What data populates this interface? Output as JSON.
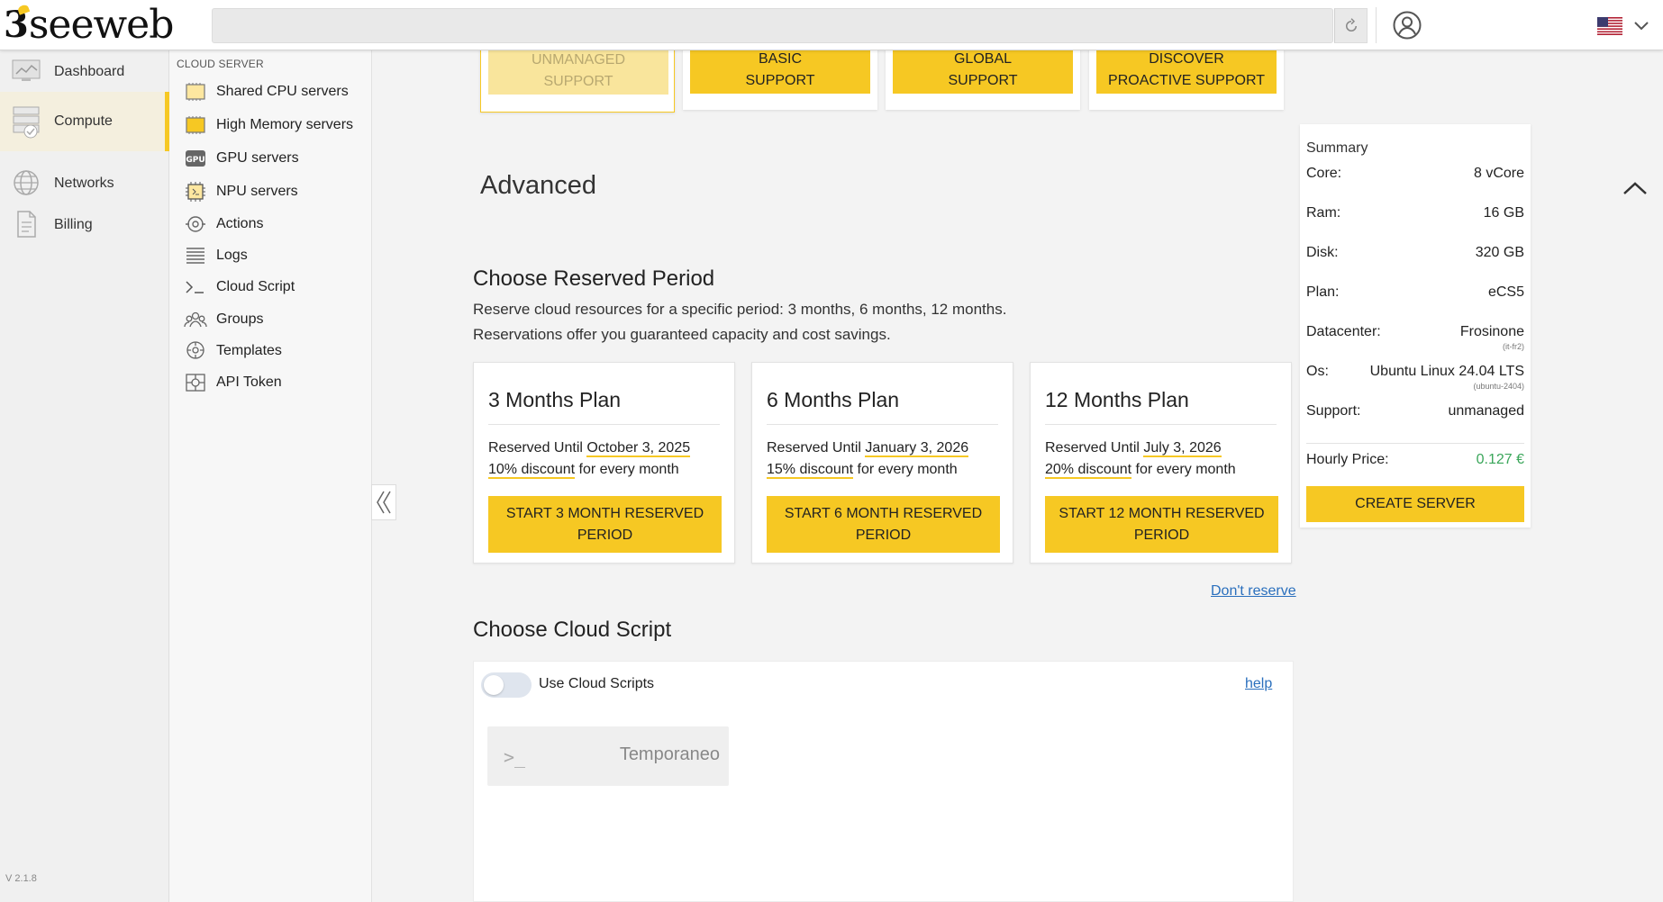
{
  "brand": {
    "name": "seeweb",
    "accent": "#f6c823"
  },
  "leftnav": {
    "items": [
      {
        "label": "Dashboard",
        "icon": "dashboard-icon"
      },
      {
        "label": "Compute",
        "icon": "server-icon",
        "active": true
      },
      {
        "label": "Networks",
        "icon": "globe-icon"
      },
      {
        "label": "Billing",
        "icon": "document-icon"
      }
    ],
    "version": "V 2.1.8"
  },
  "submenu": {
    "header": "CLOUD SERVER",
    "items": [
      {
        "label": "Shared CPU servers",
        "icon": "cpu-chip-icon"
      },
      {
        "label": "High Memory servers",
        "icon": "memory-chip-icon"
      },
      {
        "label": "GPU servers",
        "icon": "gpu-icon"
      },
      {
        "label": "NPU servers",
        "icon": "npu-icon"
      },
      {
        "label": "Actions",
        "icon": "actions-icon"
      },
      {
        "label": "Logs",
        "icon": "logs-icon"
      },
      {
        "label": "Cloud Script",
        "icon": "terminal-icon"
      },
      {
        "label": "Groups",
        "icon": "groups-icon"
      },
      {
        "label": "Templates",
        "icon": "templates-icon"
      },
      {
        "label": "API Token",
        "icon": "api-token-icon"
      }
    ]
  },
  "support": {
    "cards": [
      {
        "line1": "UNMANAGED",
        "line2": "SUPPORT",
        "selected": true
      },
      {
        "line1": "BASIC",
        "line2": "SUPPORT"
      },
      {
        "line1": "GLOBAL",
        "line2": "SUPPORT"
      },
      {
        "line1": "DISCOVER",
        "line2": "PROACTIVE SUPPORT"
      }
    ]
  },
  "advanced": {
    "title": "Advanced"
  },
  "reserved": {
    "title": "Choose Reserved Period",
    "desc1": "Reserve cloud resources for a specific period: 3 months, 6 months, 12 months.",
    "desc2": "Reservations offer you guaranteed capacity and cost savings.",
    "plans": [
      {
        "title": "3 Months Plan",
        "until_prefix": "Reserved Until ",
        "until": "October 3, 2025",
        "discount": "10% discount",
        "suffix": " for every month",
        "btn1": "START 3 MONTH RESERVED",
        "btn2": "PERIOD"
      },
      {
        "title": "6 Months Plan",
        "until_prefix": "Reserved Until ",
        "until": "January 3, 2026",
        "discount": "15% discount",
        "suffix": " for every month",
        "btn1": "START 6 MONTH RESERVED",
        "btn2": "PERIOD"
      },
      {
        "title": "12 Months Plan",
        "until_prefix": "Reserved Until ",
        "until": "July 3, 2026",
        "discount": "20% discount",
        "suffix": " for every month",
        "btn1": "START 12 MONTH RESERVED",
        "btn2": "PERIOD"
      }
    ],
    "dont_reserve": "Don't reserve"
  },
  "cloud_script": {
    "title": "Choose Cloud Script",
    "toggle_label": "Use Cloud Scripts",
    "toggle_on": false,
    "help": "help",
    "tile_icon": ">_",
    "tile_name": "Temporaneo"
  },
  "summary": {
    "title": "Summary",
    "rows": [
      {
        "k": "Core:",
        "v": "8 vCore"
      },
      {
        "k": "Ram:",
        "v": "16 GB"
      },
      {
        "k": "Disk:",
        "v": "320 GB"
      },
      {
        "k": "Plan:",
        "v": "eCS5"
      },
      {
        "k": "Datacenter:",
        "v": "Frosinone",
        "sub": "(it-fr2)"
      },
      {
        "k": "Os:",
        "v": "Ubuntu Linux 24.04 LTS",
        "sub": "(ubuntu-2404)"
      },
      {
        "k": "Support:",
        "v": "unmanaged"
      }
    ],
    "price_label": "Hourly Price:",
    "price_value": "0.127 €",
    "create_label": "CREATE SERVER"
  }
}
